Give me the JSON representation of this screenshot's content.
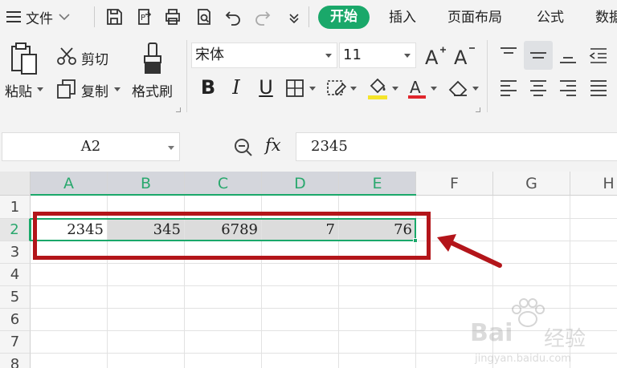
{
  "menubar": {
    "file_label": "文件",
    "tabs": [
      "开始",
      "插入",
      "页面布局",
      "公式",
      "数据"
    ],
    "active_tab": "开始",
    "accent_color": "#1aa86a"
  },
  "quick_access": {
    "icons": [
      "save-icon",
      "export-icon",
      "print-icon",
      "print-preview-icon",
      "undo-icon",
      "redo-icon",
      "customize-icon"
    ]
  },
  "ribbon": {
    "paste_label": "粘贴",
    "cut_label": "剪切",
    "copy_label": "复制",
    "format_painter_label": "格式刷",
    "font_name": "宋体",
    "font_size": "11",
    "font_buttons": [
      "increase-font-icon",
      "decrease-font-icon",
      "bold-icon",
      "italic-icon",
      "underline-icon",
      "border-icon",
      "clear-format-icon",
      "fill-color-icon",
      "font-color-icon",
      "eraser-icon"
    ],
    "align_buttons": [
      "align-top-icon",
      "align-middle-icon",
      "align-bottom-icon",
      "indent-icon",
      "align-left-icon",
      "align-center-icon",
      "align-right-icon",
      "justify-icon"
    ],
    "bold_glyph": "B",
    "italic_glyph": "I",
    "underline_glyph": "U",
    "fill_color": "#f5e42a",
    "font_color": "#e0262c"
  },
  "formula_bar": {
    "name_box": "A2",
    "fx_label": "fx",
    "formula_value": "2345"
  },
  "grid": {
    "columns": [
      "A",
      "B",
      "C",
      "D",
      "E",
      "F",
      "G",
      "H"
    ],
    "selected_columns": [
      "A",
      "B",
      "C",
      "D",
      "E"
    ],
    "rows": [
      "1",
      "2",
      "3",
      "4",
      "5",
      "6",
      "7",
      "8"
    ],
    "selected_row": "2",
    "row2_values": [
      "2345",
      "345",
      "6789",
      "7",
      "76"
    ]
  },
  "annotation": {
    "highlight_color": "#b3151a"
  },
  "watermark": {
    "brand_text": "Bai",
    "brand_text2": "经验",
    "url_text": "jingyan.baidu.com"
  }
}
